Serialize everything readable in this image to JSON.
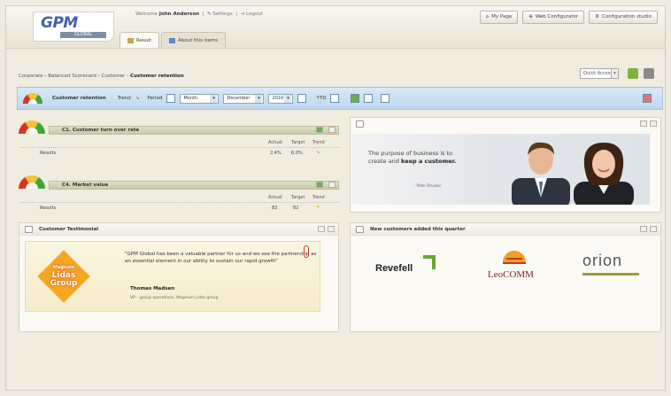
{
  "brand": {
    "name": "GPM",
    "sub": "GLOBAL"
  },
  "user_bar": {
    "welcome": "Welcome",
    "user": "John Anderson",
    "settings": "Settings",
    "logout": "Logout",
    "sep": "|"
  },
  "header_buttons": [
    "My Page",
    "Web Configurator",
    "Configuration studio"
  ],
  "tabs": [
    {
      "label": "Result",
      "active": true
    },
    {
      "label": "About this items",
      "active": false
    }
  ],
  "breadcrumb": {
    "items": [
      "Corporate",
      "Balanced Scorecard",
      "Customer"
    ],
    "current": "Customer retention",
    "sep": "›"
  },
  "quick_access": "Quick Access",
  "scorecard_bar": {
    "title": "Customer retention",
    "trend_label": "Trend",
    "period_label": "Period",
    "period_type": "Month",
    "month": "December",
    "year": "2010",
    "ytd_label": "YTD"
  },
  "kpis": [
    {
      "title": "C1. Customer turn over rate",
      "cols": [
        "Actual",
        "Target",
        "Trend"
      ],
      "row_label": "Results",
      "actual": "2.4%",
      "target": "6.0%"
    },
    {
      "title": "C4. Market value",
      "cols": [
        "Actual",
        "Target",
        "Trend"
      ],
      "row_label": "Results",
      "actual": "83",
      "target": "82"
    }
  ],
  "quote_panel": {
    "line1": "The purpose of business is to",
    "line2_prefix": "create and",
    "line2_bold": "keep a customer.",
    "author": "- Peter Drucker"
  },
  "testimonial": {
    "title": "Customer Testimonial",
    "logo_top": "Magnum",
    "logo_mid": "Lidas",
    "logo_bot": "Group",
    "quote": "\"GPM Global has been a valuable partner for us and we see the partnership as an essential element in our ability to sustain our rapid growth\"",
    "name": "Thomas Madsen",
    "role": "VP – group operations, Magnum Lidas group"
  },
  "new_customers": {
    "title": "New customers added this quarter",
    "logos": [
      "Revefell",
      "LeoCOMM",
      "orion"
    ]
  },
  "colors": {
    "brand_blue": "#3f63a8",
    "bar_blue": "#bfd7ee",
    "green": "#69a82f",
    "orange": "#f5a623"
  }
}
